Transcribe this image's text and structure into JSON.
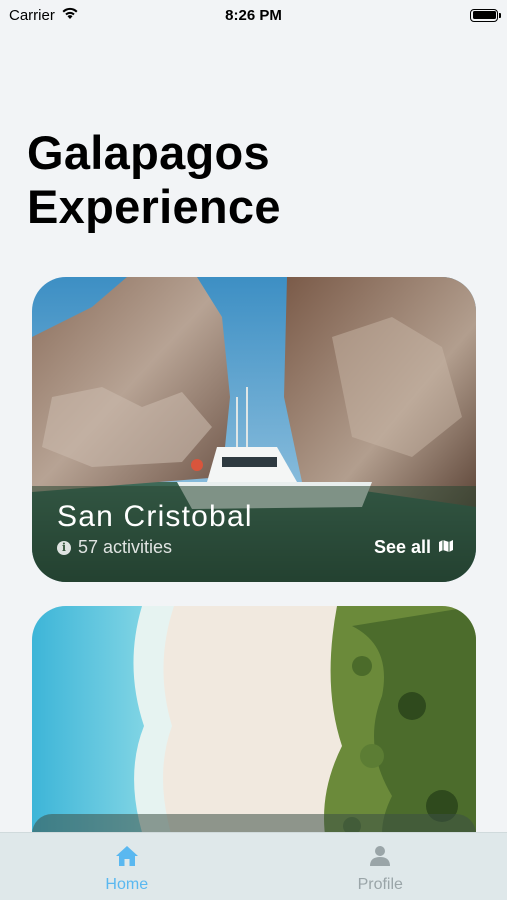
{
  "status_bar": {
    "carrier": "Carrier",
    "time": "8:26 PM"
  },
  "page": {
    "title_line1": "Galapagos",
    "title_line2": "Experience"
  },
  "cards": [
    {
      "title": "San Cristobal",
      "activities": "57 activities",
      "see_all": "See all"
    }
  ],
  "tab_bar": {
    "tabs": [
      {
        "label": "Home",
        "icon": "home-icon",
        "active": true
      },
      {
        "label": "Profile",
        "icon": "user-icon",
        "active": false
      }
    ]
  },
  "colors": {
    "background": "#f2f4f6",
    "active_tab": "#5ab8f0",
    "inactive_tab": "#9aa5a8",
    "tab_bar_bg": "#dfe8ea"
  }
}
